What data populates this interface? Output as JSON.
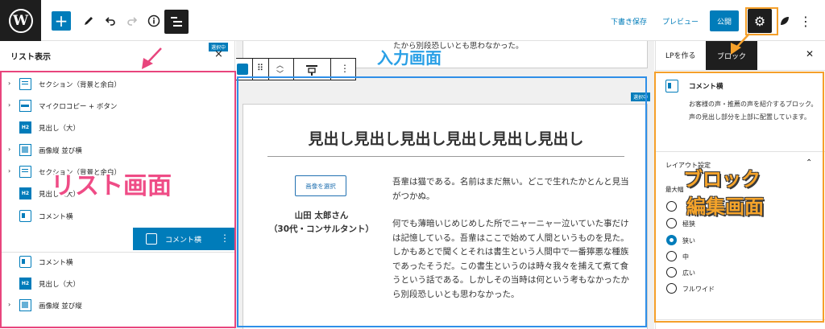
{
  "toolbar": {
    "save_draft": "下書き保存",
    "preview": "プレビュー",
    "publish": "公開"
  },
  "list_panel": {
    "title": "リスト表示",
    "items": [
      {
        "label": "セクション（背景と余白）",
        "icon": "section-icon"
      },
      {
        "label": "マイクロコピー + ボタン",
        "icon": "microcopy-button-icon"
      },
      {
        "label": "見出し（大）",
        "icon": "heading-h2-icon"
      },
      {
        "label": "画像縦 並び横",
        "icon": "image-icon"
      },
      {
        "label": "セクション（背景と余白）",
        "icon": "section-icon"
      },
      {
        "label": "見出し（大）",
        "icon": "heading-h2-icon"
      },
      {
        "label": "コメント横",
        "icon": "comment-icon"
      },
      {
        "label": "コメント横",
        "icon": "comment-icon",
        "selected": true
      },
      {
        "label": "コメント横",
        "icon": "comment-icon"
      },
      {
        "label": "見出し（大）",
        "icon": "heading-h2-icon"
      },
      {
        "label": "画像縦 並び縦",
        "icon": "image-icon"
      }
    ],
    "selected_tag": "選択中",
    "h2_badge": "H2"
  },
  "canvas": {
    "top_text": "たから別段恐しいとも思わなかった。",
    "selected_tag": "選択中",
    "heading": "見出し見出し見出し見出し見出し見出し",
    "image_button": "画像を選択",
    "person_name": "山田 太郎さん",
    "person_detail": "（30代・コンサルタント）",
    "paragraph1": "吾輩は猫である。名前はまだ無い。どこで生れたかとんと見当がつかぬ。",
    "paragraph2": "何でも薄暗いじめじめした所でニャーニャー泣いていた事だけは記憶している。吾輩はここで始めて人間というものを見た。しかもあとで聞くとそれは書生という人間中で一番獰悪な種族であったそうだ。この書生というのは時々我々を捕えて煮て食うという話である。しかしその当時は何という考もなかったから別段恐しいとも思わなかった。"
  },
  "sidebar": {
    "tab_document": "LPを作る",
    "tab_block": "ブロック",
    "block_name": "コメント横",
    "block_desc": "お客様の声・推薦の声を紹介するブロック。声の見出し部分を上部に配置しています。",
    "layout_label": "レイアウト設定",
    "max_width_label": "最大幅",
    "width_options": [
      {
        "label": "",
        "checked": false
      },
      {
        "label": "極狭",
        "checked": false
      },
      {
        "label": "狭い",
        "checked": true
      },
      {
        "label": "中",
        "checked": false
      },
      {
        "label": "広い",
        "checked": false
      },
      {
        "label": "フルワイド",
        "checked": false
      }
    ]
  },
  "annotations": {
    "list_label": "リスト画面",
    "input_label": "入力画面",
    "block_label_1": "ブロック",
    "block_label_2": "編集画面",
    "pink": "#e8457d",
    "blue": "#2e8fe8",
    "orange": "#f5a02a"
  },
  "colors": {
    "wp_blue": "#007cba",
    "dark": "#1e1e1e"
  }
}
